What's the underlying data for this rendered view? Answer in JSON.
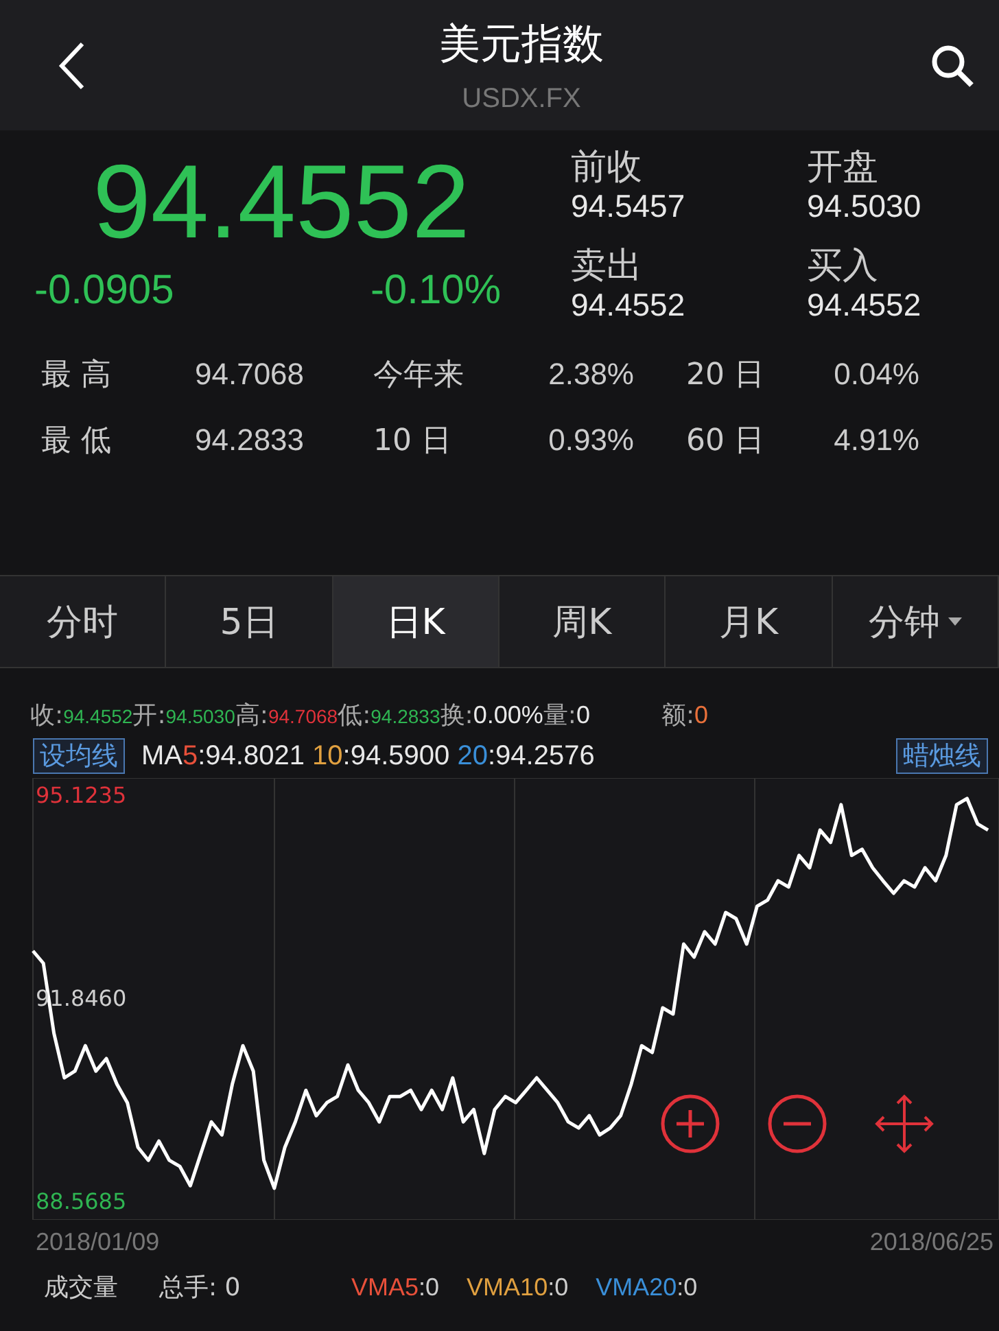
{
  "header": {
    "title": "美元指数",
    "subtitle": "USDX.FX"
  },
  "quote": {
    "price": "94.4552",
    "change": "-0.0905",
    "change_pct": "-0.10%",
    "fields": [
      {
        "label": "前收",
        "value": "94.5457"
      },
      {
        "label": "开盘",
        "value": "94.5030"
      },
      {
        "label": "卖出",
        "value": "94.4552"
      },
      {
        "label": "买入",
        "value": "94.4552"
      }
    ]
  },
  "stats": [
    [
      {
        "label": "最 高",
        "value": "94.7068"
      },
      {
        "label": "今年来",
        "value": "2.38%"
      },
      {
        "label": "20 日",
        "value": "0.04%"
      }
    ],
    [
      {
        "label": "最 低",
        "value": "94.2833"
      },
      {
        "label": "10 日",
        "value": "0.93%"
      },
      {
        "label": "60 日",
        "value": "4.91%"
      }
    ]
  ],
  "tabs": [
    {
      "label": "分时",
      "selected": false,
      "kind": "plain"
    },
    {
      "label": "5日",
      "selected": false,
      "kind": "plain"
    },
    {
      "label": "日K",
      "selected": true,
      "kind": "plain"
    },
    {
      "label": "周K",
      "selected": false,
      "kind": "plain"
    },
    {
      "label": "月K",
      "selected": false,
      "kind": "plain"
    },
    {
      "label": "分钟",
      "selected": false,
      "kind": "dropdown"
    }
  ],
  "info": [
    {
      "label": "收:",
      "value": "94.4552",
      "color": "#2fb552"
    },
    {
      "label": "开:",
      "value": "94.5030",
      "color": "#2fb552"
    },
    {
      "label": "高:",
      "value": "94.7068",
      "color": "#e0323a"
    },
    {
      "label": "低:",
      "value": "94.2833",
      "color": "#2fb552"
    },
    {
      "label": "换:",
      "value": "0.00%",
      "color": "#e8e8e8"
    },
    {
      "label": "量:",
      "value": "0",
      "color": "#e8e8e8"
    },
    {
      "label": "额:",
      "value": "0",
      "color": "#e8703a"
    }
  ],
  "ma": {
    "button": "设均线",
    "prefix": "MA",
    "items": [
      {
        "name": "5",
        "value": ":94.8021",
        "color": "#e8503a"
      },
      {
        "name": "10",
        "value": ":94.5900",
        "color": "#e0a040"
      },
      {
        "name": "20",
        "value": ":94.2576",
        "color": "#3a8fd8"
      }
    ],
    "style_button": "蜡烛线"
  },
  "chart": {
    "start_date": "2018/01/09",
    "end_date": "2018/06/25",
    "chart_data": {
      "type": "line",
      "ylim": [
        88.259,
        95.389
      ],
      "yticks": [
        95.1235,
        {
          "value": 91.846,
          "label": "91.8460"
        },
        88.5685
      ],
      "series": [
        {
          "color": "#ffffff",
          "values": [
            92.6,
            92.4,
            91.27,
            90.55,
            90.66,
            91.07,
            90.66,
            90.86,
            90.45,
            90.15,
            89.43,
            89.22,
            89.53,
            89.22,
            89.12,
            88.81,
            89.33,
            89.84,
            89.63,
            90.45,
            91.07,
            90.66,
            89.22,
            88.77,
            89.43,
            89.84,
            90.35,
            89.94,
            90.15,
            90.25,
            90.76,
            90.35,
            90.15,
            89.84,
            90.25,
            90.25,
            90.35,
            90.04,
            90.35,
            90.04,
            90.55,
            89.84,
            90.04,
            89.33,
            90.04,
            90.25,
            90.15,
            90.35,
            90.55,
            90.35,
            90.15,
            89.84,
            89.74,
            89.94,
            89.63,
            89.74,
            89.94,
            90.45,
            91.07,
            90.96,
            91.68,
            91.58,
            92.71,
            92.5,
            92.91,
            92.71,
            93.22,
            93.12,
            92.71,
            93.32,
            93.42,
            93.73,
            93.63,
            94.14,
            93.94,
            94.55,
            94.35,
            94.96,
            94.14,
            94.24,
            93.94,
            93.73,
            93.53,
            93.73,
            93.63,
            93.94,
            93.73,
            94.14,
            94.96,
            95.06,
            94.65,
            94.55
          ]
        }
      ]
    }
  },
  "volume": {
    "label": "成交量",
    "total_label": "总手:",
    "total": "0",
    "items": [
      {
        "name": "VMA5",
        "value": ":0",
        "color": "#e8503a"
      },
      {
        "name": "VMA10",
        "value": ":0",
        "color": "#e0a040"
      },
      {
        "name": "VMA20",
        "value": ":0",
        "color": "#3a8fd8"
      }
    ]
  }
}
